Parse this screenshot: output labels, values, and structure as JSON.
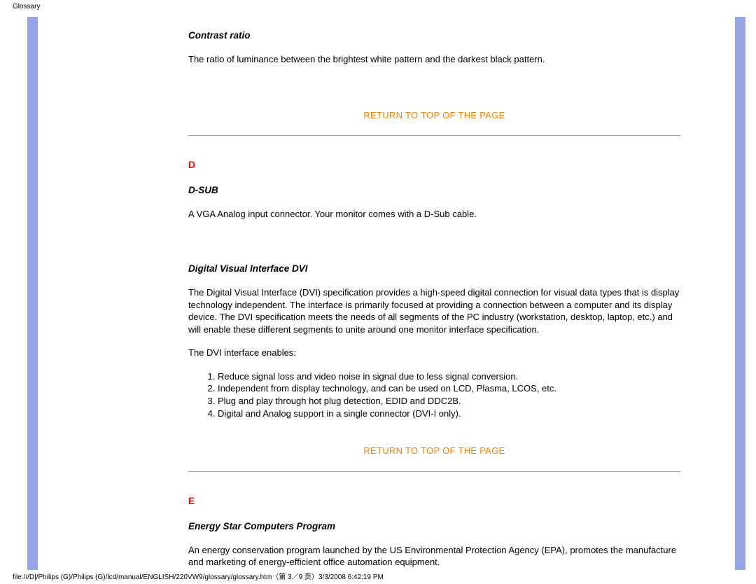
{
  "header": {
    "label": "Glossary"
  },
  "entries": {
    "contrast_ratio": {
      "title": "Contrast ratio",
      "text": "The ratio of luminance between the brightest white pattern and the darkest black pattern."
    },
    "d_letter": "D",
    "d_sub": {
      "title": "D-SUB",
      "text": "A VGA Analog input connector. Your monitor comes with a D-Sub cable."
    },
    "dvi": {
      "title": "Digital Visual Interface DVI",
      "text": "The Digital Visual Interface (DVI) specification provides a high-speed digital connection for visual data types that is display technology independent. The interface is primarily focused at providing a connection between a computer and its display device. The DVI specification meets the needs of all segments of the PC industry (workstation, desktop, laptop, etc.) and will enable these different segments to unite around one monitor interface specification.",
      "enables_intro": "The DVI interface enables:",
      "enables": [
        "Reduce signal loss and video noise in signal due to less signal conversion.",
        "Independent from display technology, and can be used on LCD, Plasma, LCOS, etc.",
        "Plug and play through hot plug detection, EDID and DDC2B.",
        "Digital and Analog support in a single connector (DVI-I only)."
      ]
    },
    "e_letter": "E",
    "energy_star": {
      "title": "Energy Star Computers Program",
      "text": "An energy conservation program launched by the US Environmental Protection Agency (EPA), promotes the manufacture and marketing of energy-efficient office automation equipment."
    }
  },
  "links": {
    "return_top": "RETURN TO TOP OF THE PAGE"
  },
  "footer": {
    "path": "file:///D|/Philips (G)/Philips (G)/lcd/manual/ENGLISH/220VW9/glossary/glossary.htm（第 3／9 页）3/3/2008 6:42:19 PM"
  }
}
